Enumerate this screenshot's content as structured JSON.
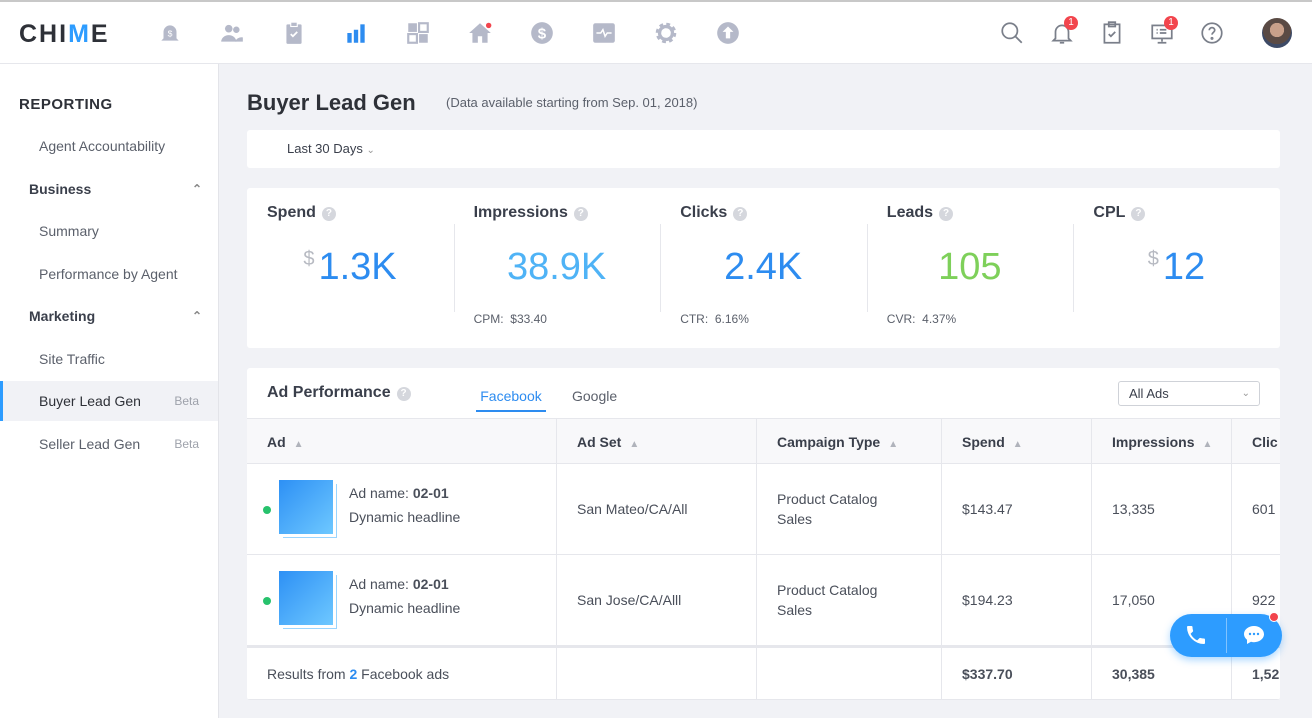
{
  "app": {
    "logo": "CHIME"
  },
  "topnav": {
    "icons": [
      "bell-dollar-icon",
      "contacts-icon",
      "clipboard-check-icon",
      "bar-chart-icon",
      "dashboard-grid-icon",
      "home-icon",
      "dollar-circle-icon",
      "activity-icon",
      "gear-icon",
      "upload-icon"
    ],
    "active": "bar-chart-icon",
    "notifications_badge": "1",
    "messages_badge": "1"
  },
  "sidebar": {
    "title": "REPORTING",
    "items": [
      {
        "label": "Agent Accountability",
        "type": "item"
      },
      {
        "label": "Business",
        "type": "group"
      },
      {
        "label": "Summary",
        "type": "item"
      },
      {
        "label": "Performance by Agent",
        "type": "item"
      },
      {
        "label": "Marketing",
        "type": "group"
      },
      {
        "label": "Site Traffic",
        "type": "item"
      },
      {
        "label": "Buyer Lead Gen",
        "type": "item",
        "badge": "Beta",
        "active": true
      },
      {
        "label": "Seller Lead Gen",
        "type": "item",
        "badge": "Beta"
      }
    ]
  },
  "page": {
    "title": "Buyer Lead Gen",
    "subtitle": "(Data available starting from Sep. 01, 2018)",
    "date_filter": "Last 30 Days"
  },
  "stats": [
    {
      "label": "Spend",
      "prefix": "$",
      "value": "1.3K",
      "sub_label": "",
      "sub_value": "",
      "color": "#2d8cf0"
    },
    {
      "label": "Impressions",
      "prefix": "",
      "value": "38.9K",
      "sub_label": "CPM:",
      "sub_value": "$33.40",
      "color": "#4fb3f6"
    },
    {
      "label": "Clicks",
      "prefix": "",
      "value": "2.4K",
      "sub_label": "CTR:",
      "sub_value": "6.16%",
      "color": "#2d8cf0"
    },
    {
      "label": "Leads",
      "prefix": "",
      "value": "105",
      "sub_label": "CVR:",
      "sub_value": "4.37%",
      "color": "#7ed05a"
    },
    {
      "label": "CPL",
      "prefix": "$",
      "value": "12",
      "sub_label": "",
      "sub_value": "",
      "color": "#2d8cf0"
    }
  ],
  "ad_performance": {
    "title": "Ad Performance",
    "tabs": [
      "Facebook",
      "Google"
    ],
    "active_tab": "Facebook",
    "filter": "All Ads",
    "columns": [
      "Ad",
      "Ad Set",
      "Campaign Type",
      "Spend",
      "Impressions",
      "Clic"
    ],
    "rows": [
      {
        "ad_label": "Ad name:",
        "ad_name": "02-01",
        "headline": "Dynamic headline",
        "ad_set": "San Mateo/CA/All",
        "campaign_type": "Product Catalog Sales",
        "spend": "$143.47",
        "impressions": "13,335",
        "clicks": "601"
      },
      {
        "ad_label": "Ad name:",
        "ad_name": "02-01",
        "headline": "Dynamic headline",
        "ad_set": "San Jose/CA/Alll",
        "campaign_type": "Product Catalog Sales",
        "spend": "$194.23",
        "impressions": "17,050",
        "clicks": "922"
      }
    ],
    "footer": {
      "prefix": "Results from",
      "count": "2",
      "suffix": "Facebook ads",
      "spend": "$337.70",
      "impressions": "30,385",
      "clicks": "1,52"
    }
  }
}
